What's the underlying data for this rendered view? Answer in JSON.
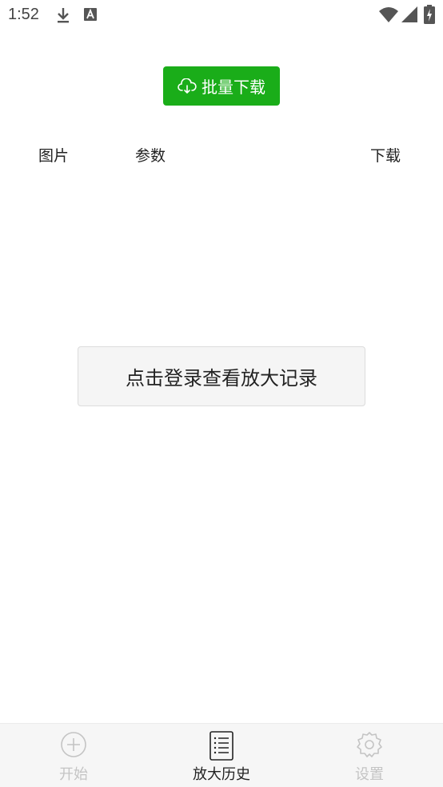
{
  "status_bar": {
    "time": "1:52",
    "icons": [
      "download-icon",
      "text-a-icon",
      "wifi-icon",
      "signal-icon",
      "battery-charging-icon"
    ]
  },
  "toolbar": {
    "batch_download_icon": "cloud-download-icon",
    "batch_download_label": "批量下载",
    "accent_color": "#1aad19"
  },
  "table": {
    "columns": [
      "图片",
      "参数",
      "下载"
    ]
  },
  "login_prompt": {
    "label": "点击登录查看放大记录"
  },
  "bottom_nav": {
    "active_index": 1,
    "items": [
      {
        "label": "开始",
        "icon": "plus-circle-icon"
      },
      {
        "label": "放大历史",
        "icon": "list-document-icon"
      },
      {
        "label": "设置",
        "icon": "gear-icon"
      }
    ]
  }
}
